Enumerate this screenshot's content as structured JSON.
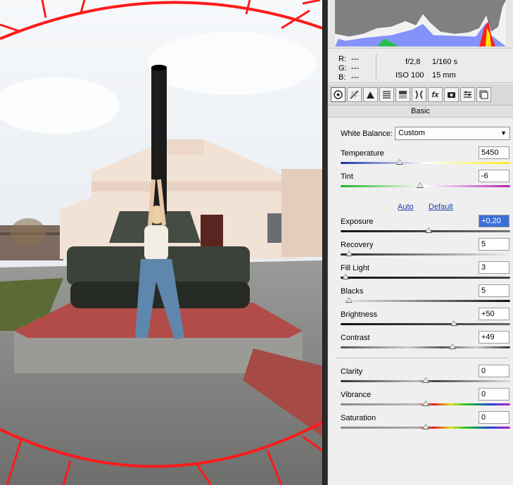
{
  "photo": {
    "description_icons": [
      "tank",
      "building",
      "woman"
    ],
    "colors": {
      "sky": "#e8ecf1",
      "building": "#f3e6dc",
      "pavement": "#8a8a8a",
      "red_marks": "#ff1a1a"
    }
  },
  "info": {
    "r_label": "R:",
    "r_value": "---",
    "g_label": "G:",
    "g_value": "---",
    "b_label": "B:",
    "b_value": "---",
    "aperture": "f/2,8",
    "shutter": "1/160 s",
    "iso": "ISO 100",
    "focal": "15 mm"
  },
  "toolbar": {
    "icons": [
      "basic-icon",
      "tone-curve-icon",
      "detail-icon",
      "hsl-icon",
      "split-toning-icon",
      "lens-corrections-icon",
      "effects-icon",
      "camera-calibration-icon",
      "presets-icon",
      "snapshots-icon"
    ],
    "fx_label": "fx"
  },
  "panel_title": "Basic",
  "white_balance": {
    "label": "White Balance:",
    "value": "Custom"
  },
  "sliders": {
    "temperature": {
      "label": "Temperature",
      "value": "5450",
      "level": 0.35
    },
    "tint": {
      "label": "Tint",
      "value": "-6",
      "level": 0.47
    },
    "exposure": {
      "label": "Exposure",
      "value": "+0,20",
      "level": 0.52
    },
    "recovery": {
      "label": "Recovery",
      "value": "5",
      "level": 0.05
    },
    "fill_light": {
      "label": "Fill Light",
      "value": "3",
      "level": 0.03
    },
    "blacks": {
      "label": "Blacks",
      "value": "5",
      "level": 0.05
    },
    "brightness": {
      "label": "Brightness",
      "value": "+50",
      "level": 0.67
    },
    "contrast": {
      "label": "Contrast",
      "value": "+49",
      "level": 0.66
    },
    "clarity": {
      "label": "Clarity",
      "value": "0",
      "level": 0.5
    },
    "vibrance": {
      "label": "Vibrance",
      "value": "0",
      "level": 0.5
    },
    "saturation": {
      "label": "Saturation",
      "value": "0",
      "level": 0.5
    }
  },
  "auto_label": "Auto",
  "default_label": "Default"
}
